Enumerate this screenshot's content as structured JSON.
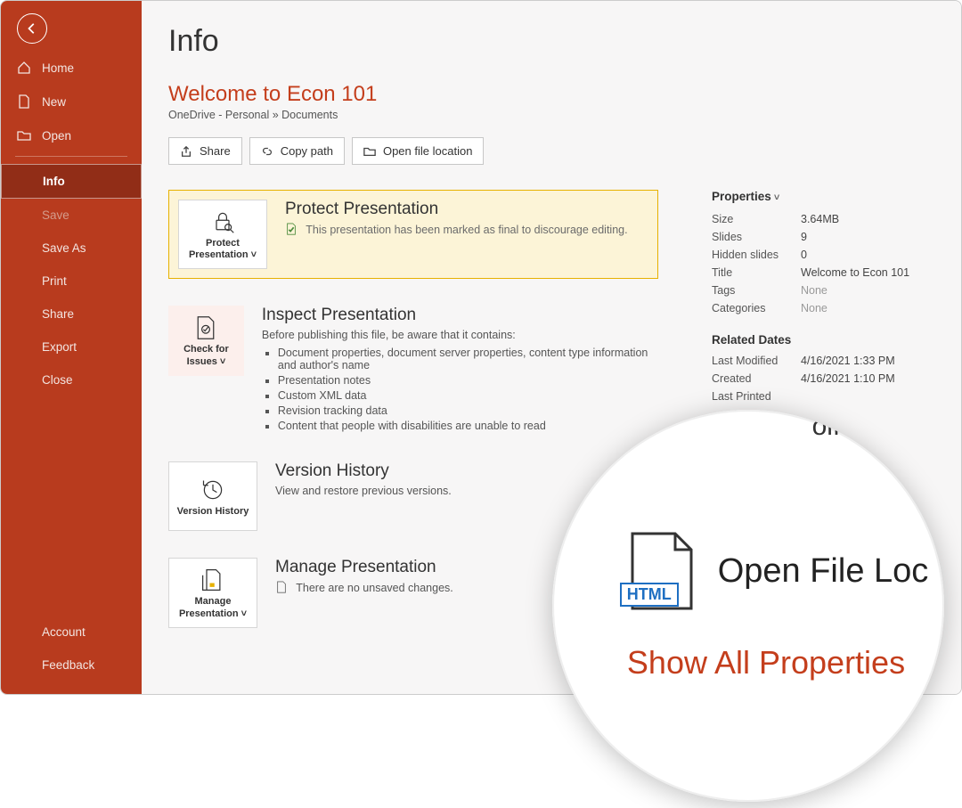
{
  "sidebar": {
    "items": {
      "home": "Home",
      "new": "New",
      "open": "Open",
      "info": "Info",
      "save": "Save",
      "saveas": "Save As",
      "print": "Print",
      "share": "Share",
      "export": "Export",
      "close": "Close",
      "account": "Account",
      "feedback": "Feedback"
    }
  },
  "header": {
    "page_title": "Info",
    "doc_title": "Welcome to Econ 101",
    "doc_path": "OneDrive - Personal » Documents",
    "actions": {
      "share": "Share",
      "copy_path": "Copy path",
      "open_location": "Open file location"
    }
  },
  "sections": {
    "protect": {
      "tile": "Protect Presentation ˅",
      "title": "Protect Presentation",
      "desc": "This presentation has been marked as final to discourage editing."
    },
    "inspect": {
      "tile": "Check for Issues ˅",
      "title": "Inspect Presentation",
      "desc": "Before publishing this file, be aware that it contains:",
      "items": [
        "Document properties, document server properties, content type information and author's name",
        "Presentation notes",
        "Custom XML data",
        "Revision tracking data",
        "Content that people with disabilities are unable to read"
      ]
    },
    "version": {
      "tile": "Version History",
      "title": "Version History",
      "desc": "View and restore previous versions."
    },
    "manage": {
      "tile": "Manage Presentation ˅",
      "title": "Manage Presentation",
      "desc": "There are no unsaved changes."
    }
  },
  "properties": {
    "heading": "Properties",
    "rows": {
      "size_k": "Size",
      "size_v": "3.64MB",
      "slides_k": "Slides",
      "slides_v": "9",
      "hidden_k": "Hidden slides",
      "hidden_v": "0",
      "title_k": "Title",
      "title_v": "Welcome to Econ 101",
      "tags_k": "Tags",
      "tags_v": "None",
      "cat_k": "Categories",
      "cat_v": "None"
    },
    "dates_heading": "Related Dates",
    "dates": {
      "mod_k": "Last Modified",
      "mod_v": "4/16/2021 1:33 PM",
      "cre_k": "Created",
      "cre_v": "4/16/2021 1:10 PM",
      "prt_k": "Last Printed",
      "prt_v": ""
    }
  },
  "magnifier": {
    "badge": "HTML",
    "open_file_loc": "Open File Loc",
    "show_all": "Show All Properties",
    "peek": "olfe"
  }
}
